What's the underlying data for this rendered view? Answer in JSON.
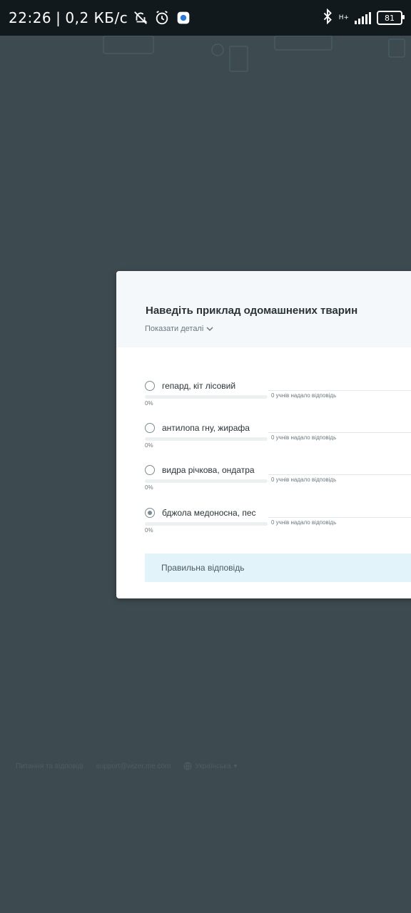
{
  "status_bar": {
    "time": "22:26",
    "separator": "|",
    "net_speed": "0,2 КБ/с",
    "network_type": "H+",
    "battery": "81",
    "icons": [
      "mute-icon",
      "alarm-icon",
      "vpn-icon",
      "bluetooth-icon",
      "signal-icon",
      "battery-icon"
    ]
  },
  "question": {
    "title": "Наведіть приклад одомашнених тварин",
    "details_toggle": "Показати деталі"
  },
  "options": [
    {
      "label": "гепард, кіт лісовий",
      "responders": "0 учнів надало відповідь",
      "percent": "0%",
      "fraction": 0,
      "selected": false
    },
    {
      "label": "антилопа гну, жирафа",
      "responders": "0 учнів надало відповідь",
      "percent": "0%",
      "fraction": 0,
      "selected": false
    },
    {
      "label": "видра річкова, ондатра",
      "responders": "0 учнів надало відповідь",
      "percent": "0%",
      "fraction": 0,
      "selected": false
    },
    {
      "label": "бджола медоносна, пес",
      "responders": "0 учнів надало відповідь",
      "percent": "0%",
      "fraction": 0,
      "selected": true
    }
  ],
  "correct_answer": {
    "label": "Правильна відповідь"
  },
  "footer": {
    "link1": "Питання та відповіді",
    "link2": "support@wizer.me.com",
    "language": "Українська"
  },
  "colors": {
    "overlay": "#3d4a50",
    "modal_bg": "#ffffff",
    "header_bg": "#f5f8fa",
    "correct_bg": "#e3f3fa"
  }
}
